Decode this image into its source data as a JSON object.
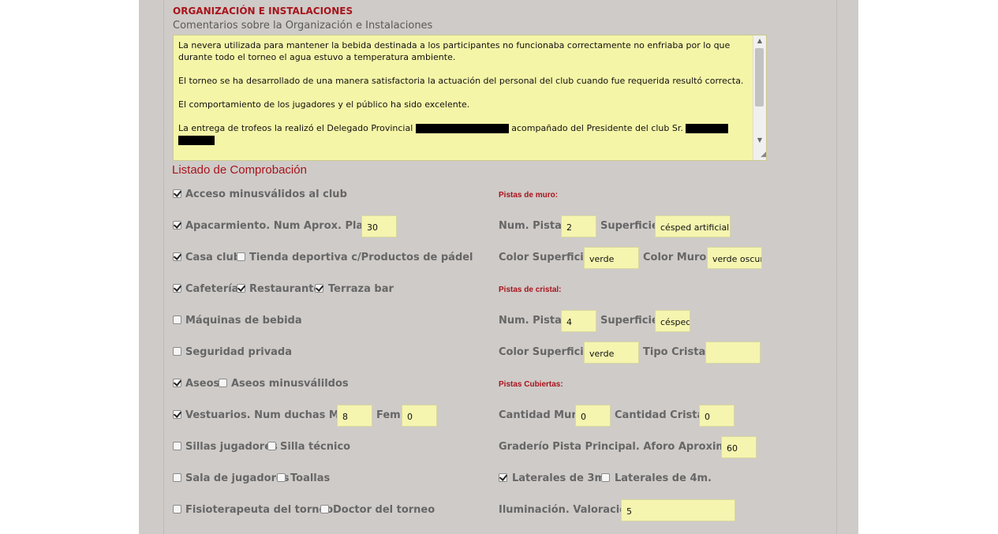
{
  "section_title": "ORGANIZACIÓN E INSTALACIONES",
  "comments_label": "Comentarios sobre la Organización e Instalaciones",
  "comments": {
    "p1": "La nevera utilizada para mantener la bebida destinada a los participantes no funcionaba correctamente no enfriaba por lo que durante todo el torneo el agua estuvo a temperatura ambiente.",
    "p2": "El torneo se ha desarrollado de una manera satisfactoria la actuación del personal del club cuando fue requerida resultó correcta.",
    "p3": "El comportamiento de los jugadores y el público ha sido excelente.",
    "p4_a": "La entrega de trofeos la realizó el Delegado Provincial",
    "p4_b": "acompañado del Presidente del club Sr."
  },
  "checklist_title": "Listado de Comprobación",
  "left": {
    "acceso": {
      "label": "Acceso minusválidos al club",
      "checked": true
    },
    "aparcamiento": {
      "label": "Apacarmiento. Num Aprox. Plazas",
      "checked": true,
      "value": "30"
    },
    "casa_club": {
      "label": "Casa club",
      "checked": true
    },
    "tienda": {
      "label": "Tienda deportiva c/Productos de pádel",
      "checked": false
    },
    "cafeteria": {
      "label": "Cafetería",
      "checked": true
    },
    "restaurante": {
      "label": "Restaurante",
      "checked": true
    },
    "terraza": {
      "label": "Terraza bar",
      "checked": true
    },
    "maquinas": {
      "label": "Máquinas de bebida",
      "checked": false
    },
    "seguridad": {
      "label": "Seguridad privada",
      "checked": false
    },
    "aseos": {
      "label": "Aseos",
      "checked": true
    },
    "aseos_min": {
      "label": "Aseos minusválildos",
      "checked": false
    },
    "vestuarios": {
      "label": "Vestuarios. Num duchas Masc",
      "checked": true,
      "value": "8"
    },
    "fem": {
      "label": "Fem",
      "value": "0"
    },
    "sillas": {
      "label": "Sillas jugadores",
      "checked": false
    },
    "silla_tecnico": {
      "label": "Silla técnico",
      "checked": false
    },
    "sala": {
      "label": "Sala de jugadores",
      "checked": false
    },
    "toallas": {
      "label": "Toallas",
      "checked": false
    },
    "fisio": {
      "label": "Fisioterapeuta del torneo",
      "checked": false
    },
    "doctor": {
      "label": "Doctor del torneo",
      "checked": false
    }
  },
  "right": {
    "muro_title": "Pistas de muro:",
    "muro_num_label": "Num. Pistas",
    "muro_num_value": "2",
    "muro_sup_label": "Superficie",
    "muro_sup_value": "césped artificial",
    "muro_color_label": "Color Superficie",
    "muro_color_value": "verde",
    "muro_muros_label": "Color Muros",
    "muro_muros_value": "verde oscuro",
    "cristal_title": "Pistas de cristal:",
    "cristal_num_label": "Num. Pistas",
    "cristal_num_value": "4",
    "cristal_sup_label": "Superficie",
    "cristal_sup_value": "césped",
    "cristal_color_label": "Color Superficie",
    "cristal_color_value": "verde",
    "cristal_tipo_label": "Tipo Cristal",
    "cristal_tipo_value": "",
    "cubiertas_title": "Pistas Cubiertas:",
    "cant_muro_label": "Cantidad Muro",
    "cant_muro_value": "0",
    "cant_cristal_label": "Cantidad Cristal",
    "cant_cristal_value": "0",
    "graderio_label": "Graderío Pista Principal. Aforo Aproximado",
    "graderio_value": "60",
    "lat3": {
      "label": "Laterales de 3m.",
      "checked": true
    },
    "lat4": {
      "label": "Laterales de 4m.",
      "checked": false
    },
    "ilum_label": "Iluminación. Valoración",
    "ilum_value": "5"
  }
}
